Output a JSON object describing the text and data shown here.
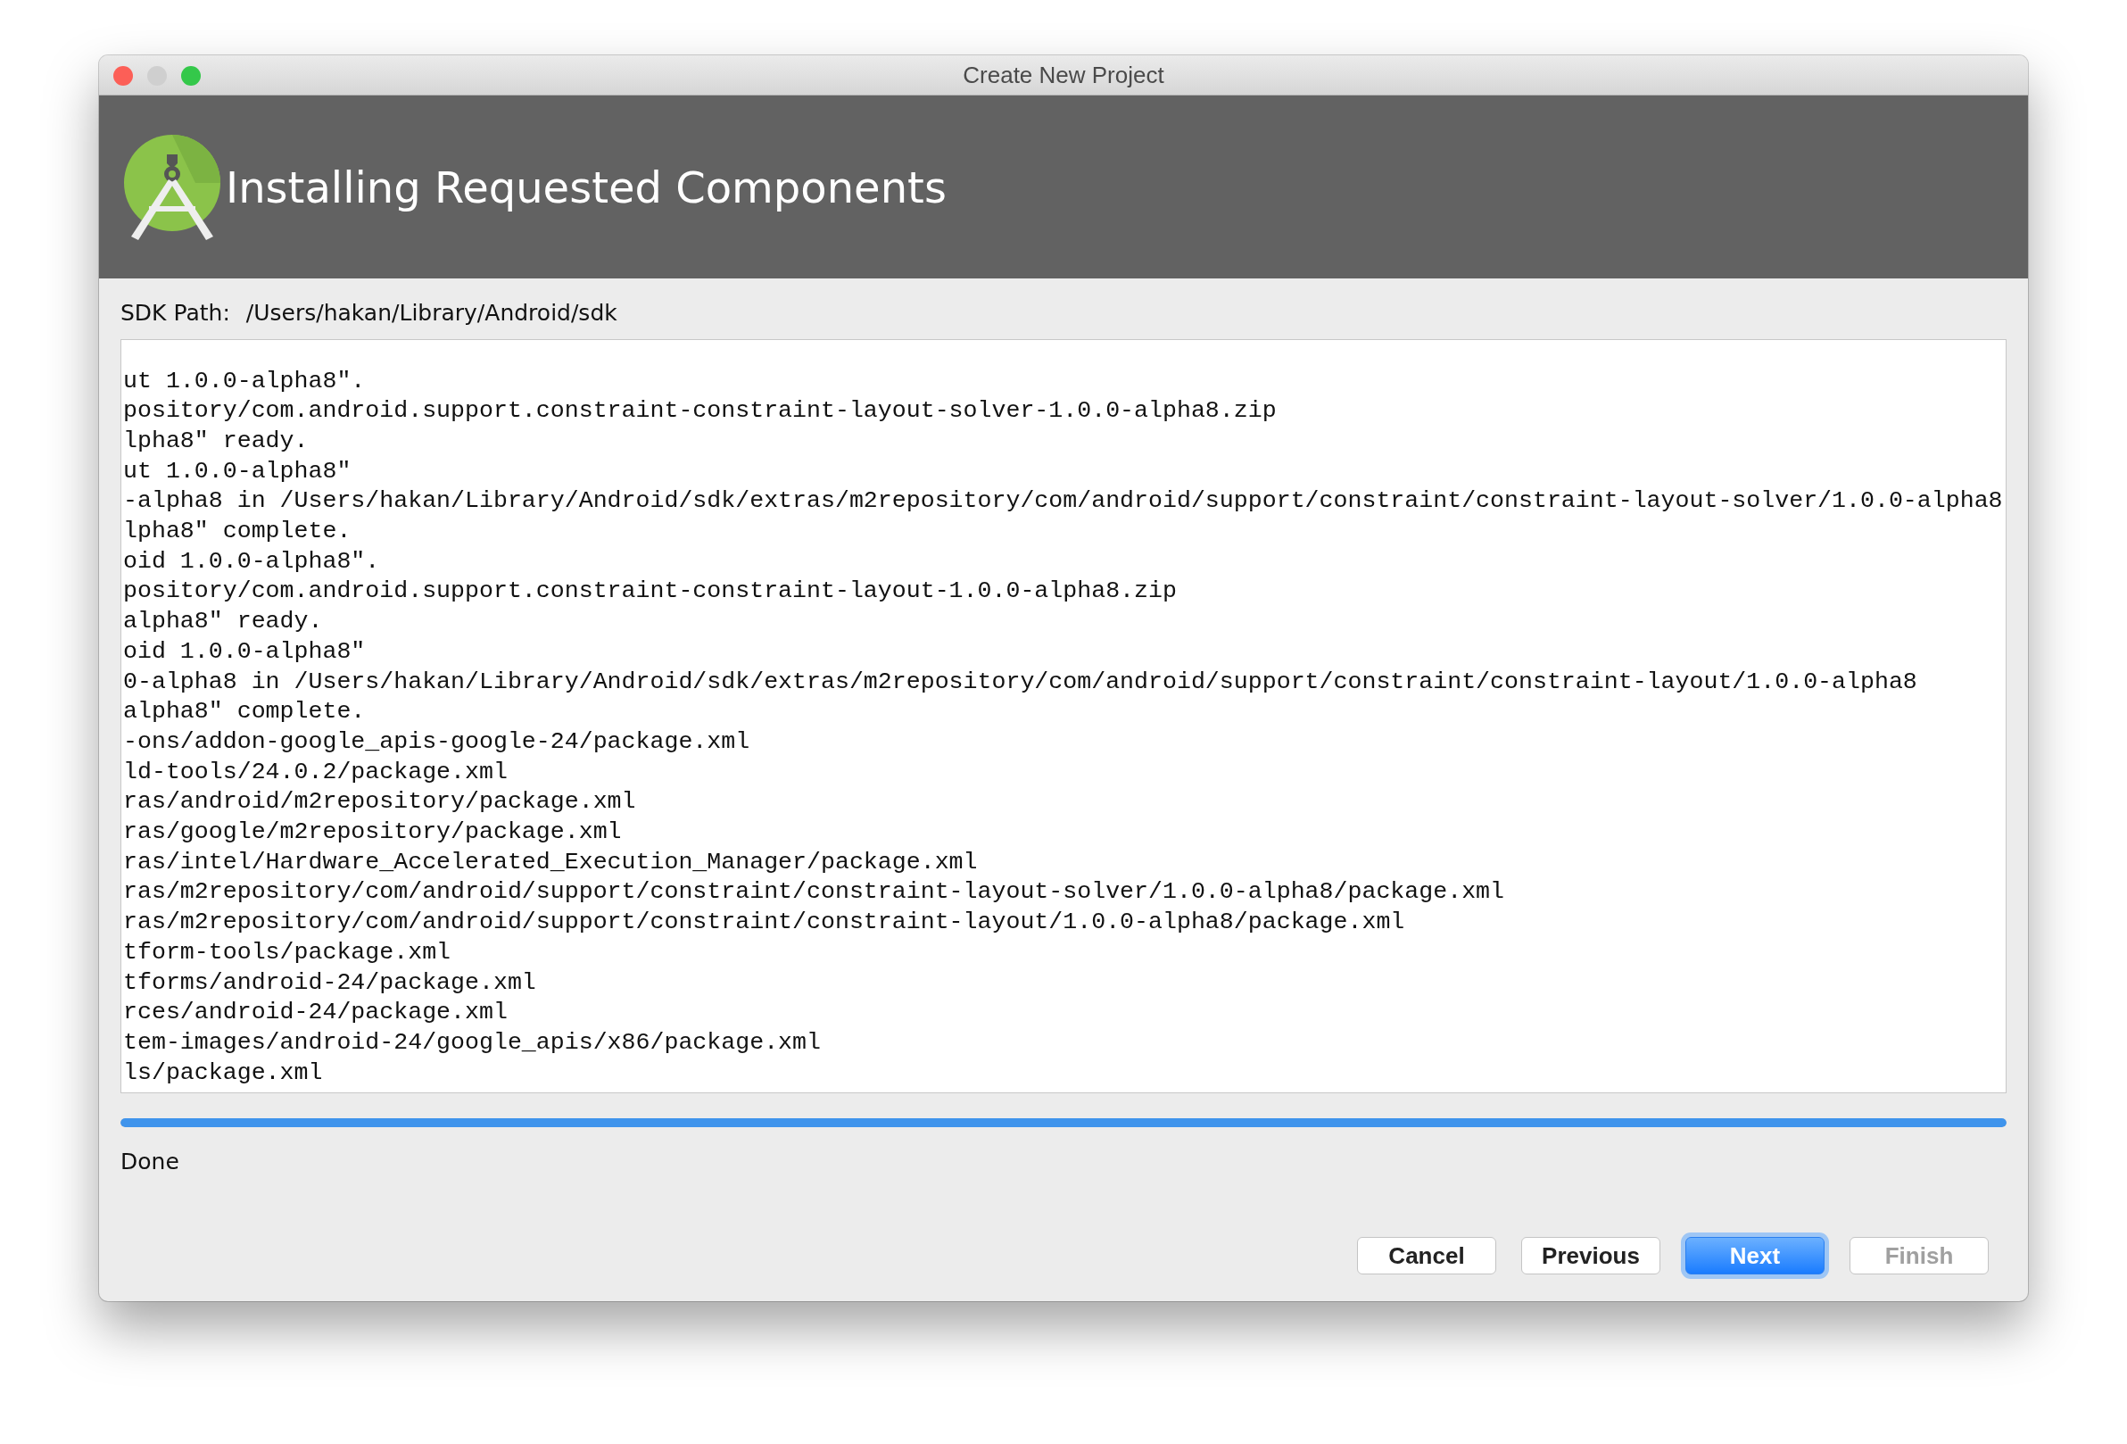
{
  "window": {
    "title": "Create New Project"
  },
  "header": {
    "title": "Installing Requested Components"
  },
  "sdk_path": {
    "label": "SDK Path:",
    "value": "/Users/hakan/Library/Android/sdk"
  },
  "log": [
    "ut 1.0.0-alpha8\".",
    "pository/com.android.support.constraint-constraint-layout-solver-1.0.0-alpha8.zip",
    "lpha8\" ready.",
    "ut 1.0.0-alpha8\"",
    "-alpha8 in /Users/hakan/Library/Android/sdk/extras/m2repository/com/android/support/constraint/constraint-layout-solver/1.0.0-alpha8",
    "lpha8\" complete.",
    "oid 1.0.0-alpha8\".",
    "pository/com.android.support.constraint-constraint-layout-1.0.0-alpha8.zip",
    "alpha8\" ready.",
    "oid 1.0.0-alpha8\"",
    "0-alpha8 in /Users/hakan/Library/Android/sdk/extras/m2repository/com/android/support/constraint/constraint-layout/1.0.0-alpha8",
    "alpha8\" complete.",
    "-ons/addon-google_apis-google-24/package.xml",
    "ld-tools/24.0.2/package.xml",
    "ras/android/m2repository/package.xml",
    "ras/google/m2repository/package.xml",
    "ras/intel/Hardware_Accelerated_Execution_Manager/package.xml",
    "ras/m2repository/com/android/support/constraint/constraint-layout-solver/1.0.0-alpha8/package.xml",
    "ras/m2repository/com/android/support/constraint/constraint-layout/1.0.0-alpha8/package.xml",
    "tform-tools/package.xml",
    "tforms/android-24/package.xml",
    "rces/android-24/package.xml",
    "tem-images/android-24/google_apis/x86/package.xml",
    "ls/package.xml"
  ],
  "progress": {
    "level": 1.0
  },
  "status": "Done",
  "buttons": [
    {
      "label": "Cancel",
      "default": false,
      "disabled": false
    },
    {
      "label": "Previous",
      "default": false,
      "disabled": false
    },
    {
      "label": "Next",
      "default": true,
      "disabled": false
    },
    {
      "label": "Finish",
      "default": false,
      "disabled": true
    }
  ]
}
